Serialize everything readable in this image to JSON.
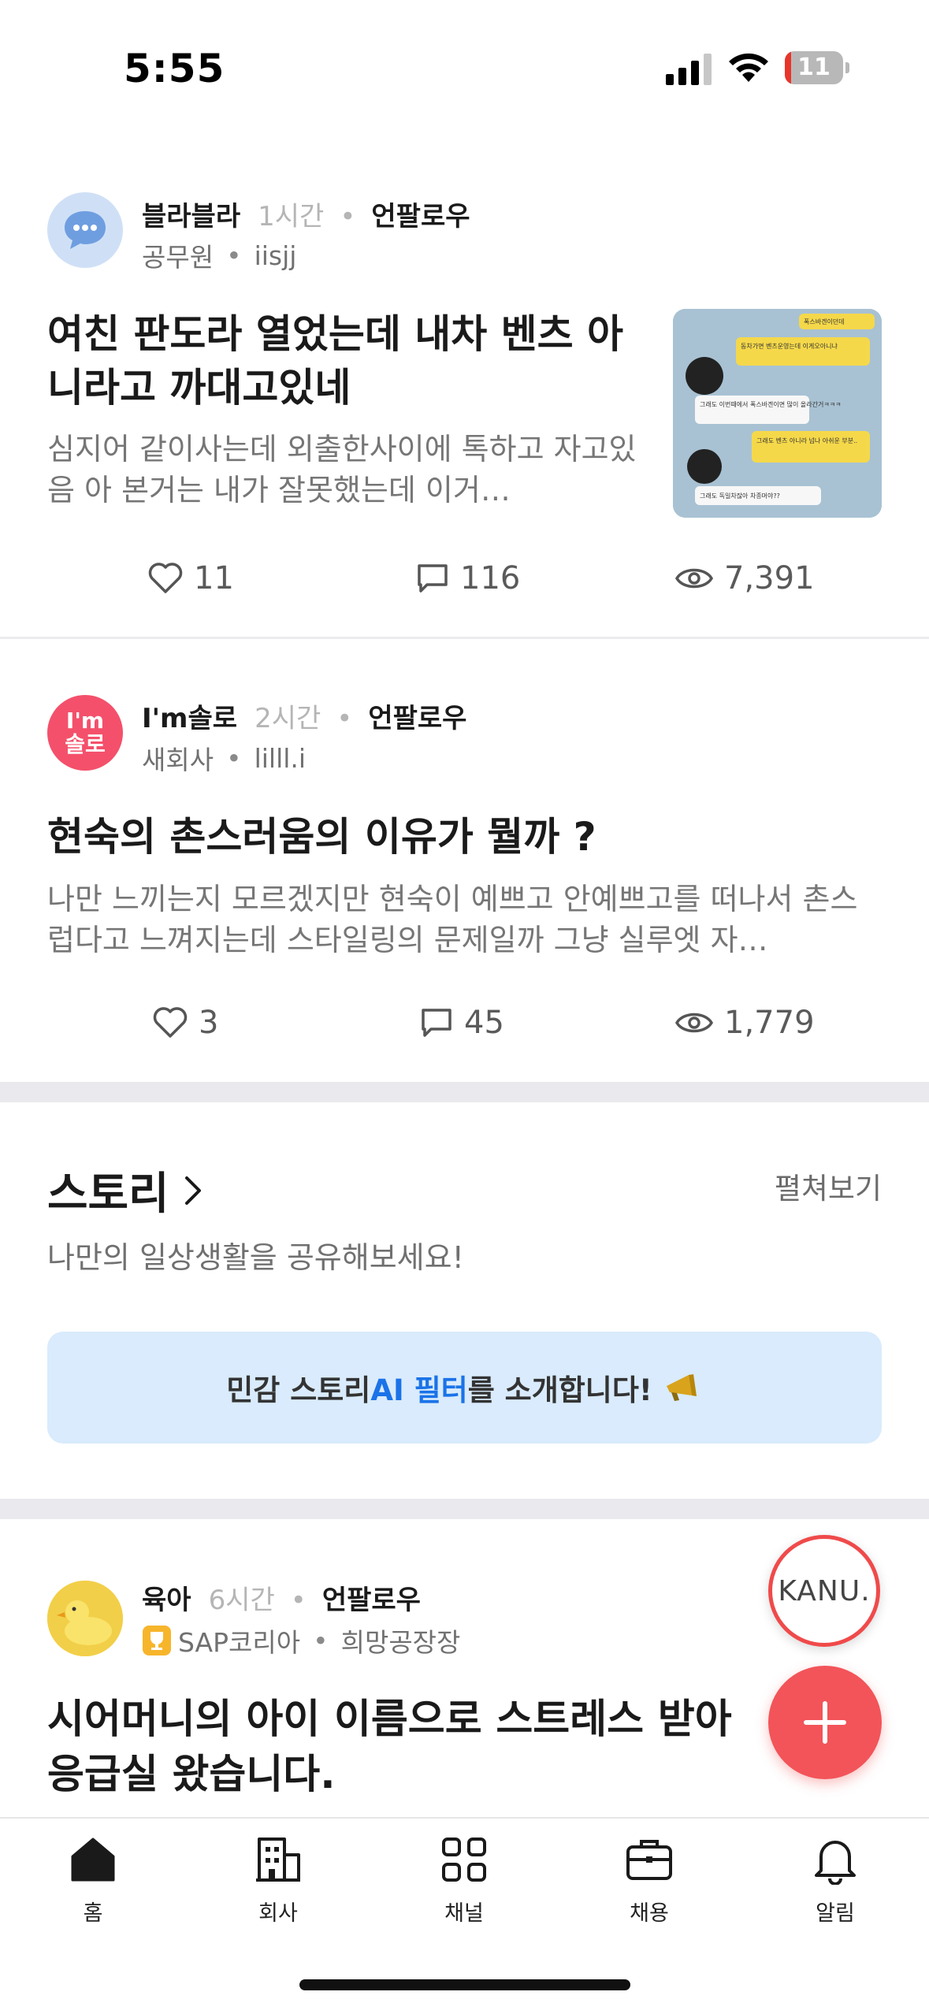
{
  "status_bar": {
    "time": "5:55",
    "battery": "11",
    "battery_level_percent": 11
  },
  "posts": [
    {
      "channel": "블라블라",
      "time": "1시간",
      "follow": "언팔로우",
      "company": "공무원",
      "nickname": "iisjj",
      "title": "여친 판도라 열었는데 내차 벤츠 아니라고 까대고있네",
      "body": "심지어 같이사는데 외출한사이에 톡하고 자고있음 아 본거는 내가 잘못했는데 이거…",
      "likes": "11",
      "comments": "116",
      "views": "7,391",
      "thumbnail_messages": [
        "폭스바겐이던데",
        "동차가면 벤츠운영는데 이게오아니냐",
        "그래도 이번때에서 폭스바겐이면 많이 올라간거ㅋㅋㅋ",
        "그래도 벤츠 아니라 넘나 아쉬운 부분..",
        "그래도 독일차잖아 차종머야??"
      ]
    },
    {
      "channel": "I'm솔로",
      "avatar_text_1": "I'm",
      "avatar_text_2": "솔로",
      "time": "2시간",
      "follow": "언팔로우",
      "company": "새회사",
      "nickname": "lilll.i",
      "title": "현숙의 촌스러움의 이유가 뭘까 ?",
      "body": "나만 느끼는지 모르겠지만  현숙이 예쁘고 안예쁘고를 떠나서 촌스럽다고 느껴지는데 스타일링의 문제일까 그냥 실루엣 자…",
      "likes": "3",
      "comments": "45",
      "views": "1,779"
    },
    {
      "channel": "육아",
      "time": "6시간",
      "follow": "언팔로우",
      "company": "SAP코리아",
      "nickname": "희망공장장",
      "title": "시어머니의 아이 이름으로 스트레스 받아 응급실 왔습니다."
    }
  ],
  "story": {
    "title": "스토리",
    "expand": "펼쳐보기",
    "subtitle": "나만의 일상생활을 공유해보세요!",
    "banner_prefix": "민감 스토리 ",
    "banner_highlight": "AI 필터",
    "banner_suffix": "를 소개합니다!"
  },
  "kanu_label": "KANU.",
  "nav": [
    {
      "label": "홈",
      "icon": "home-icon"
    },
    {
      "label": "회사",
      "icon": "building-icon"
    },
    {
      "label": "채널",
      "icon": "grid-icon"
    },
    {
      "label": "채용",
      "icon": "briefcase-icon"
    },
    {
      "label": "알림",
      "icon": "bell-icon"
    }
  ],
  "colors": {
    "accent": "#f25459",
    "banner_bg": "#d9ebfc",
    "banner_highlight": "#1a73e8"
  }
}
